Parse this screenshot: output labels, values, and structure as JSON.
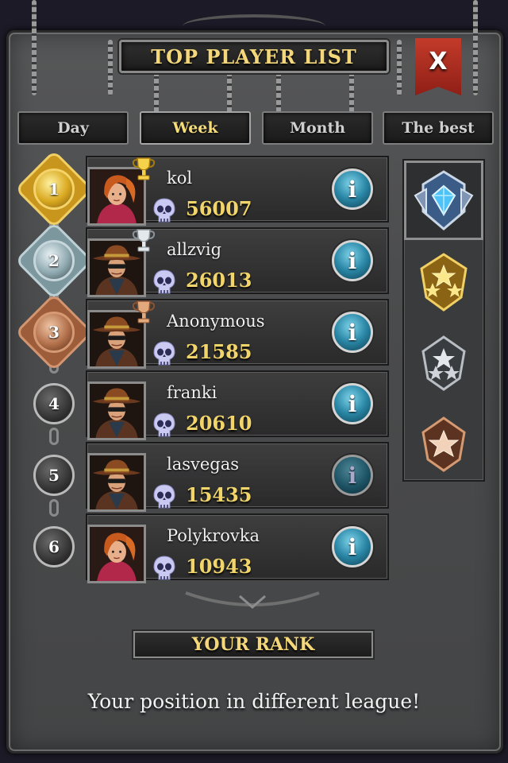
{
  "header": {
    "title": "TOP PLAYER LIST",
    "close_label": "X"
  },
  "tabs": [
    {
      "label": "Day",
      "active": false
    },
    {
      "label": "Week",
      "active": true
    },
    {
      "label": "Month",
      "active": false
    },
    {
      "label": "The best",
      "active": false
    }
  ],
  "players": [
    {
      "rank": "1",
      "name": "kol",
      "score": "56007",
      "medal": "gold",
      "trophy": "gold-trophy",
      "avatar": "female-hero"
    },
    {
      "rank": "2",
      "name": "allzvig",
      "score": "26013",
      "medal": "silver",
      "trophy": "silver-trophy",
      "avatar": "cowboy-hero"
    },
    {
      "rank": "3",
      "name": "Anonymous",
      "score": "21585",
      "medal": "bronze",
      "trophy": "bronze-trophy",
      "avatar": "cowboy-hero"
    },
    {
      "rank": "4",
      "name": "franki",
      "score": "20610",
      "medal": "plain",
      "trophy": null,
      "avatar": "cowboy-hero"
    },
    {
      "rank": "5",
      "name": "lasvegas",
      "score": "15435",
      "medal": "plain",
      "trophy": null,
      "avatar": "cowboy-hero"
    },
    {
      "rank": "6",
      "name": "Polykrovka",
      "score": "10943",
      "medal": "plain",
      "trophy": null,
      "avatar": "female-hero"
    }
  ],
  "info_label": "i",
  "leagues": [
    {
      "name": "diamond-league-icon",
      "selected": true
    },
    {
      "name": "gold-league-icon",
      "selected": false
    },
    {
      "name": "silver-league-icon",
      "selected": false
    },
    {
      "name": "bronze-league-icon",
      "selected": false
    }
  ],
  "your_rank": {
    "title": "YOUR RANK",
    "message": "Your position in different league!"
  },
  "colors": {
    "gold_text": "#f3d77a",
    "score_text": "#f1d56a",
    "close_red": "#c33b2a",
    "info_blue": "#2a87a6"
  }
}
